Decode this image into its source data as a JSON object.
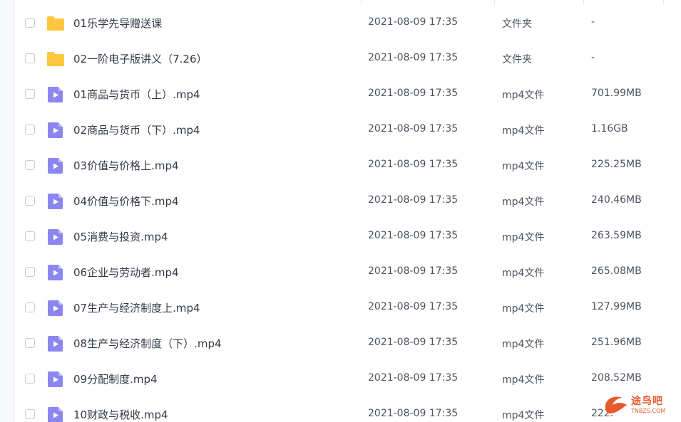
{
  "colors": {
    "folder": "#ffc741",
    "video": "#8c86f0",
    "text": "#333a45",
    "meta": "#4d545f"
  },
  "files": [
    {
      "name": "01乐学先导赠送课",
      "date": "2021-08-09 17:35",
      "type": "文件夹",
      "size": "-",
      "icon": "folder-icon"
    },
    {
      "name": "02一阶电子版讲义（7.26）",
      "date": "2021-08-09 17:35",
      "type": "文件夹",
      "size": "-",
      "icon": "folder-icon"
    },
    {
      "name": "01商品与货币（上）.mp4",
      "date": "2021-08-09 17:35",
      "type": "mp4文件",
      "size": "701.99MB",
      "icon": "video-file-icon"
    },
    {
      "name": "02商品与货币（下）.mp4",
      "date": "2021-08-09 17:35",
      "type": "mp4文件",
      "size": "1.16GB",
      "icon": "video-file-icon"
    },
    {
      "name": "03价值与价格上.mp4",
      "date": "2021-08-09 17:35",
      "type": "mp4文件",
      "size": "225.25MB",
      "icon": "video-file-icon"
    },
    {
      "name": "04价值与价格下.mp4",
      "date": "2021-08-09 17:35",
      "type": "mp4文件",
      "size": "240.46MB",
      "icon": "video-file-icon"
    },
    {
      "name": "05消费与投资.mp4",
      "date": "2021-08-09 17:35",
      "type": "mp4文件",
      "size": "263.59MB",
      "icon": "video-file-icon"
    },
    {
      "name": "06企业与劳动者.mp4",
      "date": "2021-08-09 17:35",
      "type": "mp4文件",
      "size": "265.08MB",
      "icon": "video-file-icon"
    },
    {
      "name": "07生产与经济制度上.mp4",
      "date": "2021-08-09 17:35",
      "type": "mp4文件",
      "size": "127.99MB",
      "icon": "video-file-icon"
    },
    {
      "name": "08生产与经济制度（下）.mp4",
      "date": "2021-08-09 17:35",
      "type": "mp4文件",
      "size": "251.96MB",
      "icon": "video-file-icon"
    },
    {
      "name": "09分配制度.mp4",
      "date": "2021-08-09 17:35",
      "type": "mp4文件",
      "size": "208.52MB",
      "icon": "video-file-icon"
    },
    {
      "name": "10财政与税收.mp4",
      "date": "2021-08-09 17:35",
      "type": "mp4文件",
      "size": "222.",
      "icon": "video-file-icon"
    }
  ],
  "watermark": {
    "title": "途鸟吧",
    "subtitle": "TNBZS.COM"
  }
}
